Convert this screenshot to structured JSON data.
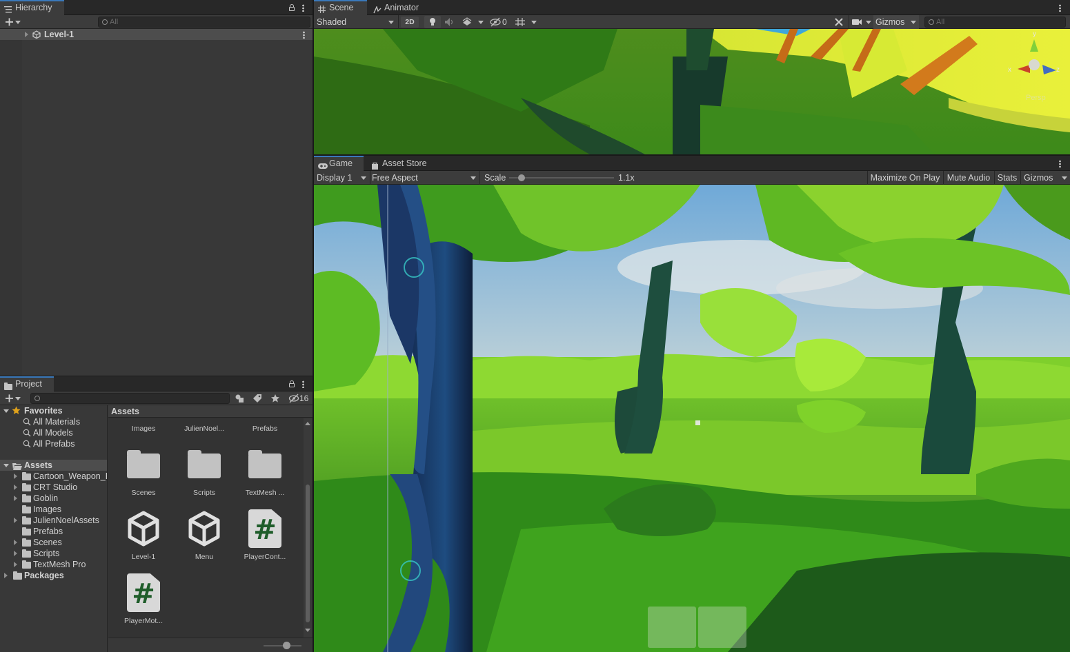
{
  "hierarchy": {
    "tab_label": "Hierarchy",
    "search_placeholder": "All",
    "scene_name": "Level-1"
  },
  "scene_view": {
    "tabs": [
      "Scene",
      "Animator"
    ],
    "shading_mode": "Shaded",
    "mode_2d": "2D",
    "hidden_count": "0",
    "gizmos_label": "Gizmos",
    "search_placeholder": "All",
    "gizmo_axes": [
      "y",
      "x",
      "z"
    ],
    "persp_label": "Persp"
  },
  "game_view": {
    "tabs": [
      "Game",
      "Asset Store"
    ],
    "display": "Display 1",
    "aspect": "Free Aspect",
    "scale_label": "Scale",
    "scale_value": "1.1x",
    "scale_fraction": 0.03,
    "buttons": [
      "Maximize On Play",
      "Mute Audio",
      "Stats",
      "Gizmos"
    ]
  },
  "project": {
    "tab_label": "Project",
    "hidden_count": "16",
    "favorites_label": "Favorites",
    "favorites": [
      "All Materials",
      "All Models",
      "All Prefabs"
    ],
    "assets_label": "Assets",
    "asset_folders": [
      "Cartoon_Weapon_P",
      "CRT Studio",
      "Goblin",
      "Images",
      "JulienNoelAssets",
      "Prefabs",
      "Scenes",
      "Scripts",
      "TextMesh Pro"
    ],
    "packages_label": "Packages",
    "breadcrumb": "Assets",
    "grid_items": [
      {
        "label": "Images",
        "kind": "folder"
      },
      {
        "label": "JulienNoel...",
        "kind": "folder"
      },
      {
        "label": "Prefabs",
        "kind": "folder"
      },
      {
        "label": "Scenes",
        "kind": "folder"
      },
      {
        "label": "Scripts",
        "kind": "folder"
      },
      {
        "label": "TextMesh ...",
        "kind": "folder"
      },
      {
        "label": "Level-1",
        "kind": "unity-scene"
      },
      {
        "label": "Menu",
        "kind": "unity-scene"
      },
      {
        "label": "PlayerCont...",
        "kind": "csharp-script"
      },
      {
        "label": "PlayerMot...",
        "kind": "csharp-script"
      }
    ]
  },
  "colors": {
    "accent": "#3a79bb",
    "panel_bg": "#383838",
    "toolbar_bg": "#3c3c3c",
    "selection_bg": "#4d4d4d",
    "favorite_star": "#e0a21b",
    "script_hash": "#1f5d2a"
  }
}
